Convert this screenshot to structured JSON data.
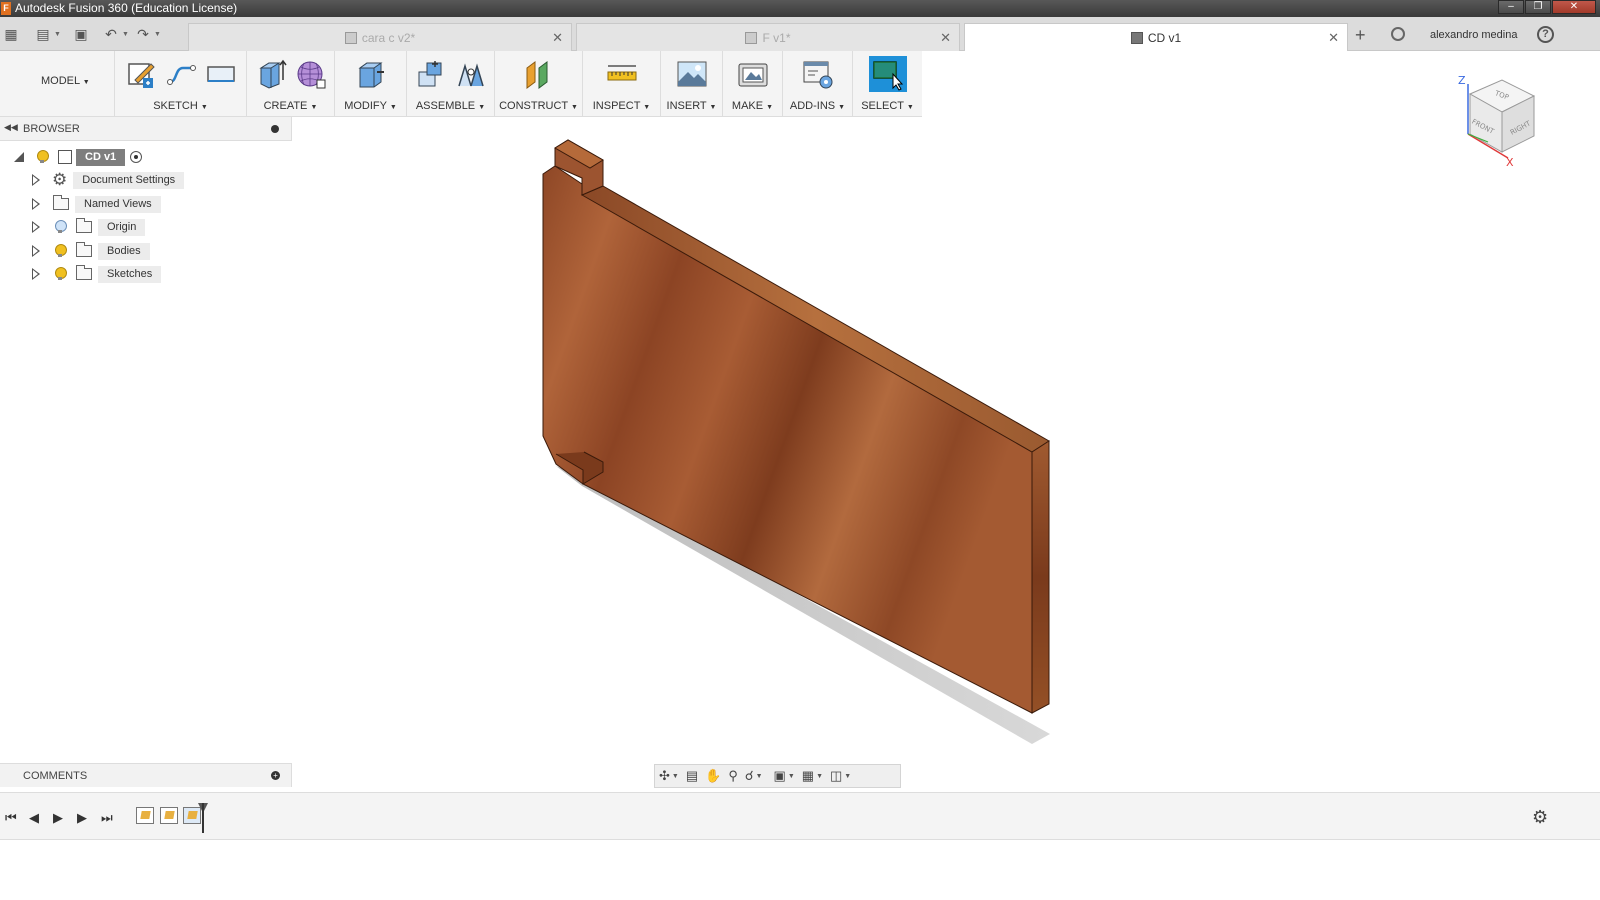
{
  "window": {
    "title": "Autodesk Fusion 360 (Education License)",
    "app_icon": "F",
    "controls": [
      "minimize",
      "restore",
      "close"
    ]
  },
  "tabs": [
    {
      "label": "cara c v2*",
      "active": false
    },
    {
      "label": "F v1*",
      "active": false
    },
    {
      "label": "CD v1",
      "active": true
    }
  ],
  "user": {
    "name": "alexandro medina"
  },
  "toolbar": {
    "workspace": "MODEL",
    "groups": [
      {
        "label": "SKETCH"
      },
      {
        "label": "CREATE"
      },
      {
        "label": "MODIFY"
      },
      {
        "label": "ASSEMBLE"
      },
      {
        "label": "CONSTRUCT"
      },
      {
        "label": "INSPECT"
      },
      {
        "label": "INSERT"
      },
      {
        "label": "MAKE"
      },
      {
        "label": "ADD-INS"
      },
      {
        "label": "SELECT"
      }
    ]
  },
  "browser": {
    "title": "BROWSER",
    "root": "CD v1",
    "items": [
      {
        "label": "Document Settings",
        "icon": "gear-icon"
      },
      {
        "label": "Named Views",
        "icon": "folder-icon"
      },
      {
        "label": "Origin",
        "icon": "folder-icon",
        "visibility": "hidden"
      },
      {
        "label": "Bodies",
        "icon": "folder-icon",
        "visibility": "visible"
      },
      {
        "label": "Sketches",
        "icon": "folder-icon",
        "visibility": "visible"
      }
    ]
  },
  "viewcube": {
    "faces": [
      "TOP",
      "FRONT",
      "RIGHT"
    ],
    "axes": [
      "Z",
      "X"
    ]
  },
  "comments": {
    "title": "COMMENTS"
  },
  "colors": {
    "accent": "#1e90d8",
    "wood": "#9a4f2a",
    "toolbar_bg": "#f4f4f4"
  }
}
